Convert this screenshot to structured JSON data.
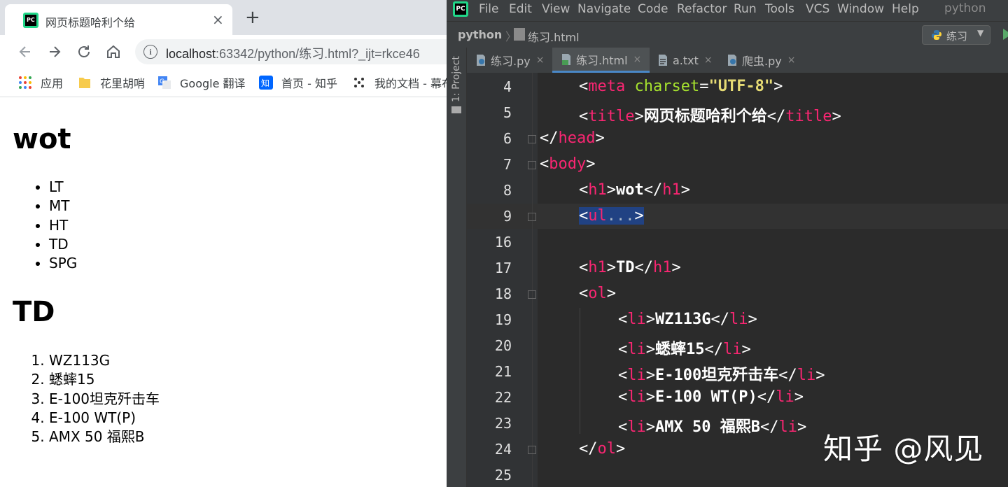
{
  "browser": {
    "tab_title": "网页标题哈利个给",
    "tab_close": "×",
    "new_tab": "+",
    "url_host": "localhost",
    "url_rest": ":63342/python/练习.html?_ijt=rkce46",
    "bookmarks": [
      {
        "label": "应用"
      },
      {
        "label": "花里胡哨"
      },
      {
        "label": "Google 翻译"
      },
      {
        "label": "首页 - 知乎"
      },
      {
        "label": "我的文档 - 幕布"
      }
    ],
    "page": {
      "h1_a": "wot",
      "ul_items": [
        "LT",
        "MT",
        "HT",
        "TD",
        "SPG"
      ],
      "h1_b": "TD",
      "ol_items": [
        "WZ113G",
        "蟋蟀15",
        "E-100坦克歼击车",
        "E-100 WT(P)",
        "AMX 50 福熙B"
      ]
    }
  },
  "ide": {
    "menu": [
      "File",
      "Edit",
      "View",
      "Navigate",
      "Code",
      "Refactor",
      "Run",
      "Tools",
      "VCS",
      "Window",
      "Help"
    ],
    "project_name": "python",
    "logo_text": "PC",
    "breadcrumb_project": "python",
    "breadcrumb_sep": "〉",
    "breadcrumb_file": "练习.html",
    "run_config": "练习",
    "side_tab": "1: Project",
    "tabs": [
      {
        "label": "练习.py"
      },
      {
        "label": "练习.html"
      },
      {
        "label": "a.txt"
      },
      {
        "label": "爬虫.py"
      }
    ],
    "tab_close": "×",
    "line_numbers": [
      "4",
      "5",
      "6",
      "7",
      "8",
      "9",
      "16",
      "17",
      "18",
      "19",
      "20",
      "21",
      "22",
      "23",
      "24",
      "25"
    ],
    "code": {
      "l4_attr": "charset",
      "l4_val": "\"UTF-8\"",
      "l5_text": "网页标题哈利个给",
      "l8_text": "wot",
      "l9_fold": "...",
      "l17_text": "TD",
      "l19_text": "WZ113G",
      "l20_text": "蟋蟀15",
      "l21_text": "E-100坦克歼击车",
      "l22_text": "E-100 WT(P)",
      "l23_text": "AMX 50 福熙B"
    }
  },
  "watermark": "知乎 @风见",
  "colors": {
    "ide_bg": "#2b2b2b",
    "tag_name": "#f92672",
    "attr": "#a6e22e",
    "string": "#e6db74",
    "selection": "#214283"
  }
}
